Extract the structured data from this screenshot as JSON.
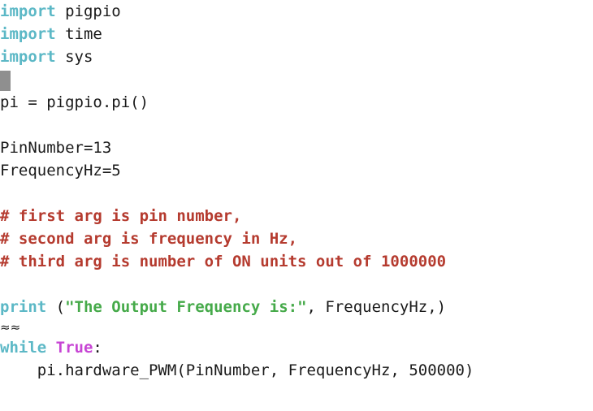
{
  "editor": {
    "language": "Python",
    "background_color": "#ffffff",
    "foreground_color": "#1a1a1a",
    "cursor": {
      "color": "#8f8f8f",
      "line_index": 3,
      "column": 0
    },
    "palette": {
      "keyword": "#5cb8c6",
      "builtin": "#5cb8c6",
      "constant": "#c745d4",
      "string": "#46aa4a",
      "comment": "#b53b2f",
      "plain": "#1a1a1a"
    }
  },
  "lines": [
    {
      "id": "line-1",
      "tokens": [
        {
          "text": "import",
          "type": "keyword"
        },
        {
          "text": " pigpio",
          "type": "plain"
        }
      ]
    },
    {
      "id": "line-2",
      "tokens": [
        {
          "text": "import",
          "type": "keyword"
        },
        {
          "text": " time",
          "type": "plain"
        }
      ]
    },
    {
      "id": "line-3",
      "tokens": [
        {
          "text": "import",
          "type": "keyword"
        },
        {
          "text": " sys",
          "type": "plain"
        }
      ]
    },
    {
      "id": "line-4",
      "cursor": true,
      "tokens": []
    },
    {
      "id": "line-5",
      "tokens": [
        {
          "text": "pi = pigpio.pi()",
          "type": "plain"
        }
      ]
    },
    {
      "id": "line-6",
      "tokens": []
    },
    {
      "id": "line-7",
      "tokens": [
        {
          "text": "PinNumber=13",
          "type": "plain"
        }
      ]
    },
    {
      "id": "line-8",
      "tokens": [
        {
          "text": "FrequencyHz=5",
          "type": "plain"
        }
      ]
    },
    {
      "id": "line-9",
      "tokens": []
    },
    {
      "id": "line-10",
      "tokens": [
        {
          "text": "# first arg is pin number,",
          "type": "comment"
        }
      ]
    },
    {
      "id": "line-11",
      "tokens": [
        {
          "text": "# second arg is frequency in Hz,",
          "type": "comment"
        }
      ]
    },
    {
      "id": "line-12",
      "tokens": [
        {
          "text": "# third arg is number of ON units out of 1000000",
          "type": "comment"
        }
      ]
    },
    {
      "id": "line-13",
      "tokens": []
    },
    {
      "id": "line-14",
      "tokens": [
        {
          "text": "print",
          "type": "builtin"
        },
        {
          "text": " (",
          "type": "plain"
        },
        {
          "text": "\"The Output Frequency is:\"",
          "type": "string"
        },
        {
          "text": ", FrequencyHz,)",
          "type": "plain"
        }
      ]
    },
    {
      "id": "line-15",
      "glyph": true,
      "tokens": [
        {
          "text": "≈≈",
          "type": "plain"
        }
      ]
    },
    {
      "id": "line-16",
      "tokens": [
        {
          "text": "while",
          "type": "keyword"
        },
        {
          "text": " ",
          "type": "plain"
        },
        {
          "text": "True",
          "type": "constant"
        },
        {
          "text": ":",
          "type": "plain"
        }
      ]
    },
    {
      "id": "line-17",
      "tokens": [
        {
          "text": "    pi.hardware_PWM(PinNumber, FrequencyHz, 500000)",
          "type": "plain"
        }
      ]
    }
  ]
}
